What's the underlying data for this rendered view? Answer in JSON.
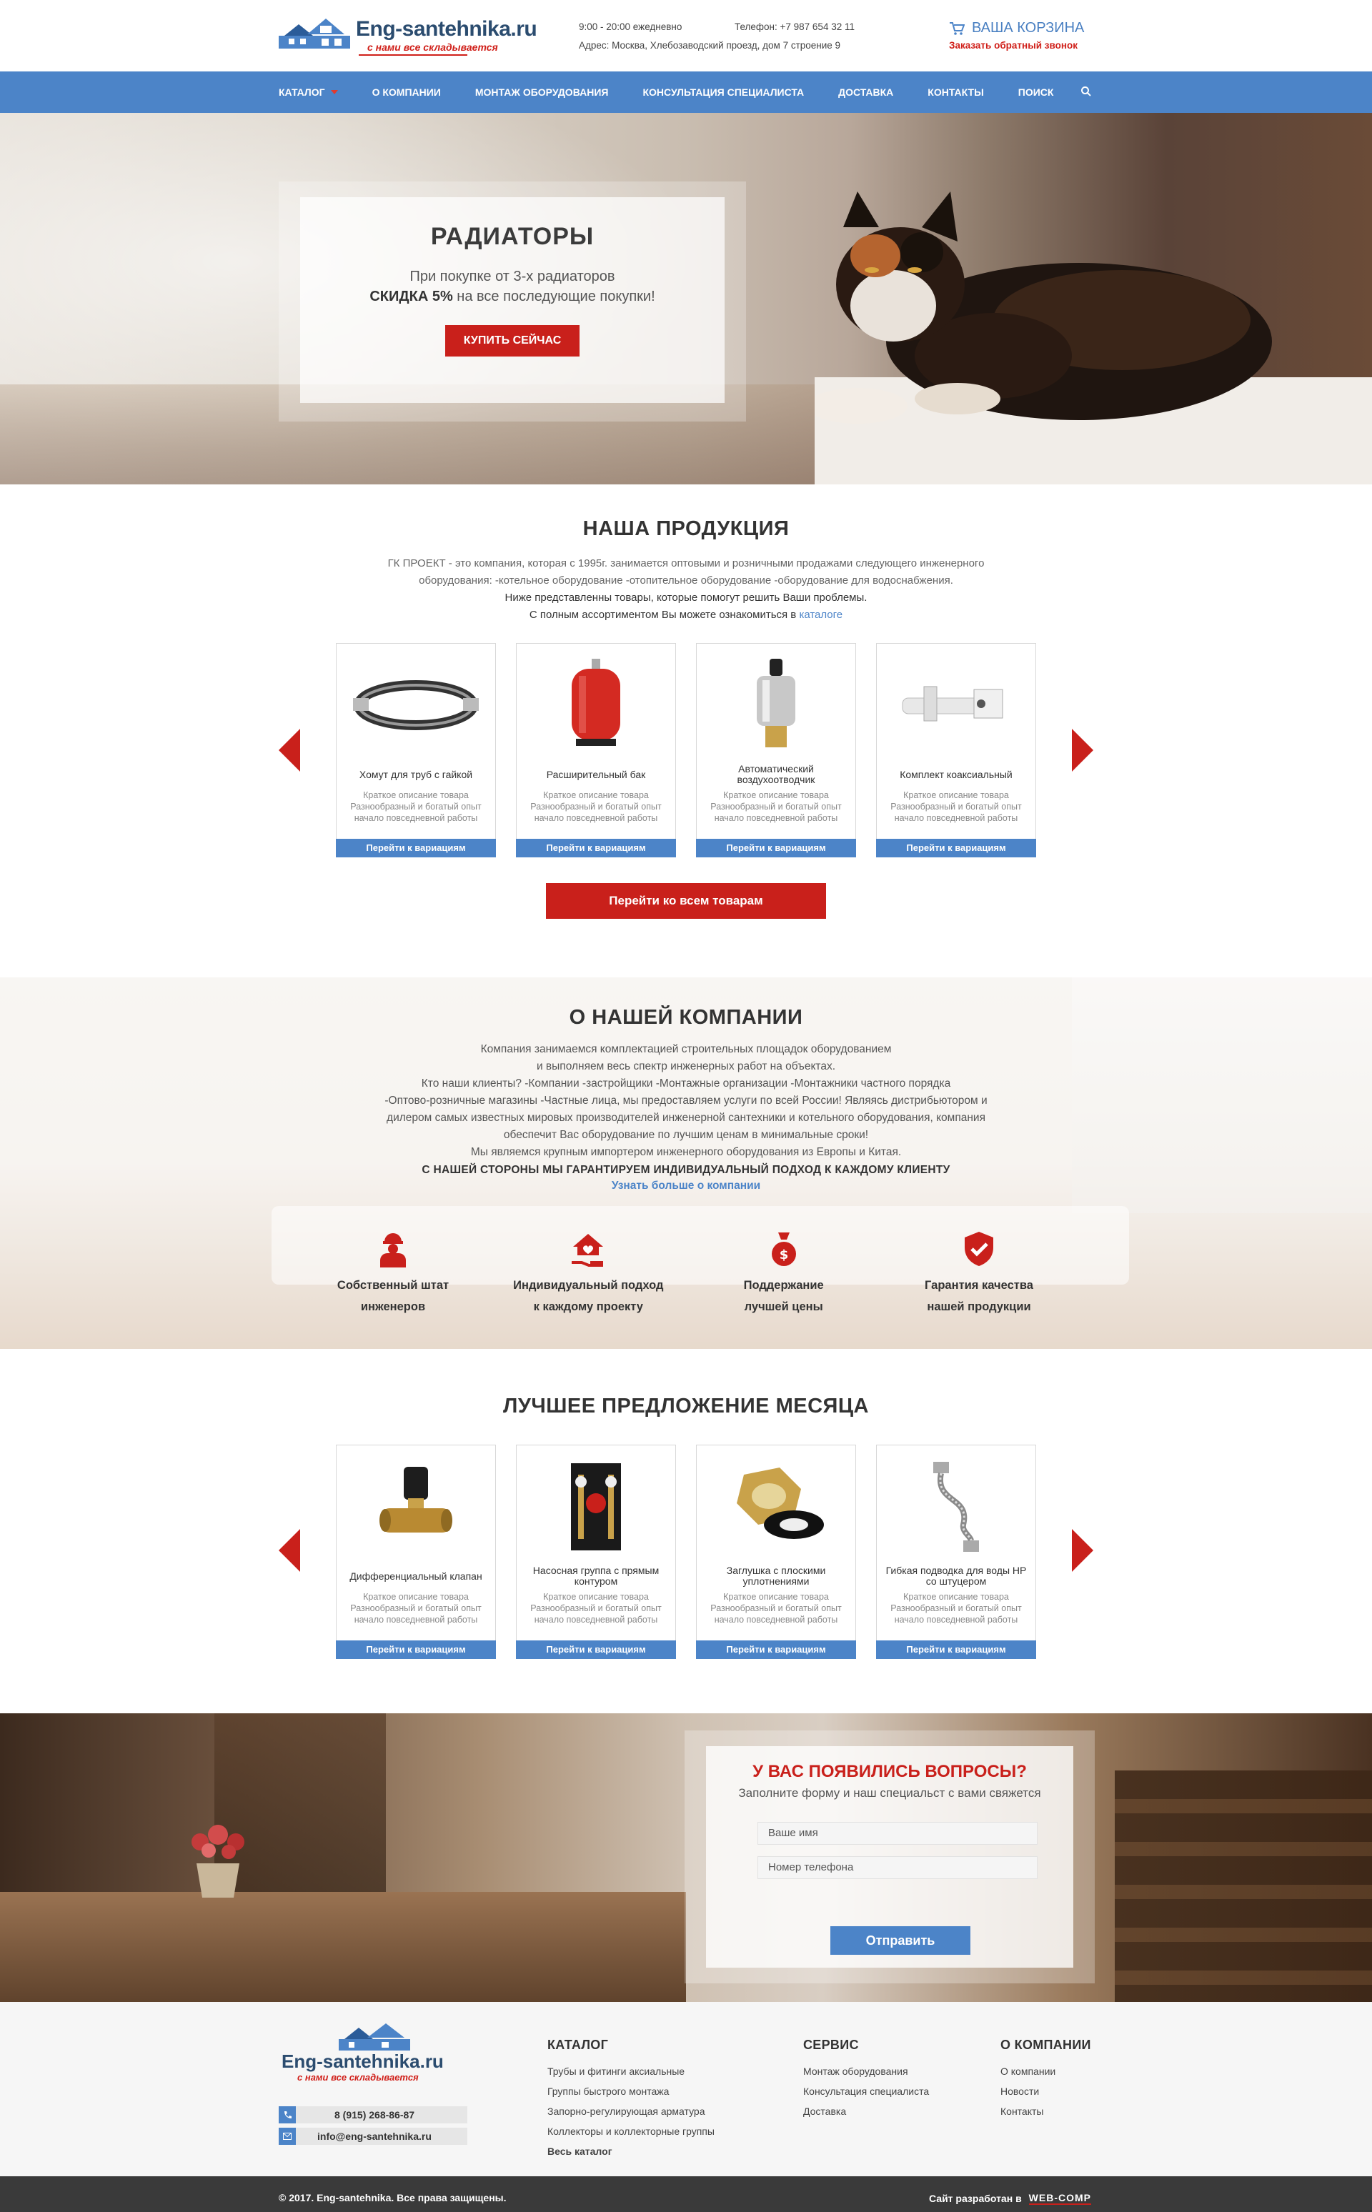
{
  "header": {
    "brand": "Eng-santehnika.ru",
    "tagline": "с нами все складывается",
    "hours": "9:00 - 20:00 ежедневно",
    "phone": "Телефон: +7 987 654 32 11",
    "address": "Адрес: Москва, Хлебозаводский проезд, дом 7 строение 9",
    "cart_label": "ВАША КОРЗИНА",
    "callback_label": "Заказать обратный звонок"
  },
  "nav": {
    "items": [
      "КАТАЛОГ",
      "О КОМПАНИИ",
      "МОНТАЖ ОБОРУДОВАНИЯ",
      "КОНСУЛЬТАЦИЯ СПЕЦИАЛИСТА",
      "ДОСТАВКА",
      "КОНТАКТЫ",
      "ПОИСК"
    ]
  },
  "hero": {
    "title": "РАДИАТОРЫ",
    "line1": "При покупке от 3-х радиаторов",
    "discount": "СКИДКА 5%",
    "line2": " на все последующие покупки!",
    "button": "КУПИТЬ СЕЙЧАС"
  },
  "products": {
    "title": "НАША ПРОДУКЦИЯ",
    "intro1": "ГК ПРОЕКТ - это компания, которая с 1995г. занимается оптовыми и розничными продажами следующего инженерного",
    "intro2": "оборудования: -котельное оборудование -отопительное оборудование -оборудование для водоснабжения.",
    "intro3": "Ниже представленны товары, которые помогут решить Ваши проблемы.",
    "intro4": "С полным ассортиментом Вы можете ознакомиться в ",
    "intro_link": "каталоге",
    "desc": "Краткое описание товара Разнообразный и богатый опыт начало повседневной работы",
    "go": "Перейти к вариациям",
    "items": [
      {
        "name": "Хомут для труб с гайкой"
      },
      {
        "name": "Расширительный бак"
      },
      {
        "name": "Автоматический воздухоотводчик"
      },
      {
        "name": "Комплект коаксиальный"
      }
    ],
    "all_button": "Перейти ко всем товарам"
  },
  "about": {
    "title": "О НАШЕЙ КОМПАНИИ",
    "p1": "Компания занимаемся комплектацией строительных площадок оборудованием",
    "p2": "и выполняем весь спектр инженерных работ на объектах.",
    "p3": "Кто наши клиенты? -Компании -застройщики -Монтажные организации -Монтажники частного порядка",
    "p4": "-Оптово-розничные магазины -Частные лица, мы предоставляем услуги по всей России! Являясь дистрибьютором и",
    "p5": "дилером самых известных мировых производителей инженерной сантехники и котельного оборудования, компания",
    "p6": "обеспечит Вас оборудование по лучшим ценам в минимальные сроки!",
    "p7": "Мы являемся крупным импортером инженерного оборудования из Европы и Китая.",
    "strong": "С НАШЕЙ СТОРОНЫ МЫ ГАРАНТИРУЕМ ИНДИВИДУАЛЬНЫЙ ПОДХОД К КАЖДОМУ КЛИЕНТУ",
    "link": "Узнать больше о компании",
    "features": [
      {
        "l1": "Собственный штат",
        "l2": "инженеров"
      },
      {
        "l1": "Индивидуальный подход",
        "l2": "к каждому проекту"
      },
      {
        "l1": "Поддержание",
        "l2": "лучшей цены"
      },
      {
        "l1": "Гарантия качества",
        "l2": "нашей продукции"
      }
    ]
  },
  "best": {
    "title": "ЛУЧШЕЕ ПРЕДЛОЖЕНИЕ МЕСЯЦА",
    "items": [
      {
        "name": "Дифференциальный клапан"
      },
      {
        "name": "Насосная группа с прямым контуром"
      },
      {
        "name": "Заглушка с плоскими уплотнениями"
      },
      {
        "name": "Гибкая подводка для воды НР со штуцером"
      }
    ]
  },
  "questions": {
    "title": "У ВАС ПОЯВИЛИСЬ ВОПРОСЫ?",
    "subtitle": "Заполните форму и наш специальст с вами свяжется",
    "name_placeholder": "Ваше имя",
    "phone_placeholder": "Номер телефона",
    "button": "Отправить"
  },
  "footer": {
    "brand": "Eng-santehnika.ru",
    "tagline": "с нами все складывается",
    "phone": "8 (915) 268-86-87",
    "email": "info@eng-santehnika.ru",
    "catalog_title": "КАТАЛОГ",
    "catalog": [
      "Трубы и фитинги аксиальные",
      "Группы быстрого монтажа",
      "Запорно-регулирующая арматура",
      "Коллекторы и коллекторные группы"
    ],
    "catalog_all": "Весь каталог",
    "service_title": "СЕРВИС",
    "service": [
      "Монтаж оборудования",
      "Консультация специалиста",
      "Доставка"
    ],
    "company_title": "О КОМПАНИИ",
    "company": [
      "О компании",
      "Новости",
      "Контакты"
    ],
    "copyright": "© 2017. Eng-santehnika. Все права защищены.",
    "dev_label": "Сайт разработан в",
    "dev_name": "WEB-COMP"
  },
  "colors": {
    "accent_blue": "#4c84c8",
    "accent_red": "#c9201b"
  }
}
